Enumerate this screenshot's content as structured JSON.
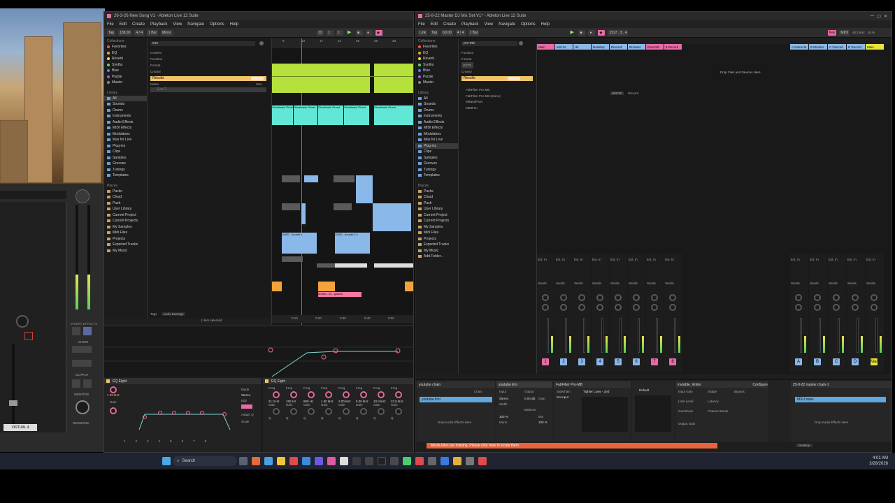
{
  "left_window": {
    "title": "26-3-26 New Song V1 - Ableton Live 12 Suite",
    "menu": [
      "File",
      "Edit",
      "Create",
      "Playback",
      "View",
      "Navigate",
      "Options",
      "Help"
    ],
    "transport": {
      "tap": "Tap",
      "tempo": "138.00",
      "sig": "4 / 4",
      "quant": "1 Bar",
      "key": "Minor",
      "pos1": "33",
      "pos2": "1",
      "pos3": "1"
    },
    "search_value": "eos",
    "collections_label": "Collections",
    "collections": [
      {
        "label": "Favorites",
        "color": "#ff5050"
      },
      {
        "label": "EQ",
        "color": "#f2a43a"
      },
      {
        "label": "Reverb",
        "color": "#e8e43a"
      },
      {
        "label": "Synths",
        "color": "#62d462"
      },
      {
        "label": "Blue",
        "color": "#4a8ae8"
      },
      {
        "label": "Purple",
        "color": "#a060e0"
      },
      {
        "label": "Master",
        "color": "#888888"
      }
    ],
    "library_label": "Library",
    "library": [
      "All",
      "Sounds",
      "Drums",
      "Instruments",
      "Audio Effects",
      "MIDI Effects",
      "Modulators",
      "Max for Live",
      "Plug-ins",
      "Clips",
      "Samples",
      "Grooves",
      "Tunings",
      "Templates"
    ],
    "places_label": "Places",
    "places": [
      "Packs",
      "Cloud",
      "Push",
      "User Library",
      "Current Project",
      "Current Projects",
      "My Samples",
      "Midi Files",
      "Projects",
      "Exported Tracks",
      "My Music"
    ],
    "filters": [
      "Content",
      "Function",
      "Format",
      "Creator"
    ],
    "results_label": "Results",
    "name_header": "Name",
    "size_header": "Size",
    "result_item": "Eos 2",
    "tags_label": "Tags",
    "tags_value": "Audio Damage",
    "status": "1 item selected",
    "clips_cyan": [
      "Ghosthack Ghost",
      "Ghosthack Ghost",
      "Ghosthack Ghost",
      "Ghosthack Ghost",
      "Ghosthack Ghost"
    ],
    "clips_lead": [
      "LEAD - Arcade 1",
      "LEAD - Arcade 1",
      "LEAD - Arcade 2.1",
      "LEAD - Arcade 2.1"
    ],
    "clip_pink": "breath - 02 - golden",
    "ruler": [
      "9",
      "13",
      "17",
      "21",
      "25",
      "29",
      "33"
    ],
    "time_ruler": [
      "0:10",
      "0:20",
      "0:30",
      "0:40",
      "0:50"
    ],
    "device_left": {
      "name": "EQ Eight",
      "mode": "Mode",
      "stereo": "Stereo",
      "edit": "Edit",
      "scale": "Scale",
      "gain": "Gain",
      "adapt": "Adapt. Q",
      "freq": "7.29 kHz",
      "bands": [
        "1",
        "2",
        "3",
        "4",
        "5",
        "6",
        "7",
        "8"
      ]
    },
    "device_right": {
      "name": "EQ Eight",
      "freq_label": "Freq",
      "gain_label": "Gain",
      "q_label": "Q",
      "freqs": [
        "21.0 Hz",
        "150 Hz",
        "800 Hz",
        "1.00 kHz",
        "2.00 kHz",
        "5.00 kHz",
        "10.0 kHz",
        "22.0 kHz"
      ]
    }
  },
  "right_window": {
    "title": "25-9-22 Master DJ Mix Set V1* - Ableton Live 12 Suite",
    "menu": [
      "File",
      "Edit",
      "Create",
      "Playback",
      "View",
      "Navigate",
      "Options",
      "Help"
    ],
    "transport": {
      "link": "Link",
      "tap": "Tap",
      "tempo": "60.00",
      "sig": "4 / 4",
      "quant": "1 Bar",
      "key": "Key",
      "midi": "MIDI",
      "sr": "44.1 kHz",
      "cpu": "15 %",
      "pos": "1517 . 3 . 4"
    },
    "search_value": "pro-mb",
    "collections_label": "Collections",
    "collections": [
      {
        "label": "Favorites",
        "color": "#ff5050"
      },
      {
        "label": "EQ",
        "color": "#f2a43a"
      },
      {
        "label": "Reverb",
        "color": "#e8e43a"
      },
      {
        "label": "Synths",
        "color": "#62d462"
      },
      {
        "label": "Blue",
        "color": "#4a8ae8"
      },
      {
        "label": "Purple",
        "color": "#a060e0"
      },
      {
        "label": "Master",
        "color": "#888888"
      }
    ],
    "library_label": "Library",
    "library": [
      "All",
      "Sounds",
      "Drums",
      "Instruments",
      "Audio Effects",
      "MIDI Effects",
      "Modulators",
      "Max for Live",
      "Plug-ins",
      "Clips",
      "Samples",
      "Grooves",
      "Tunings",
      "Templates"
    ],
    "places_label": "Places",
    "places": [
      "Packs",
      "Cloud",
      "Push",
      "User Library",
      "Current Project",
      "Current Projects",
      "My Samples",
      "Midi Files",
      "Projects",
      "Exported Tracks",
      "My Music",
      "Add Folder..."
    ],
    "filters": [
      "Function",
      "Format",
      "VST3",
      "Creator"
    ],
    "results_label": "Results",
    "results": [
      "FabFilter Pro-MB",
      "FabFilter Pro-MB (Mono)",
      "MBandPass",
      "MBitFun"
    ],
    "tracks": [
      {
        "name": "Main",
        "color": "#e86aa6"
      },
      {
        "name": "Mid Gr",
        "color": "#8ab8e8"
      },
      {
        "name": "Hit",
        "color": "#8ab8e8"
      },
      {
        "name": "Desktop",
        "color": "#8ab8e8"
      },
      {
        "name": "Discord",
        "color": "#8ab8e8"
      },
      {
        "name": "Browser",
        "color": "#8ab8e8"
      },
      {
        "name": "Rekordb",
        "color": "#e86aa6"
      },
      {
        "name": "8 Record",
        "color": "#e86aa6"
      }
    ],
    "return_tracks": [
      {
        "name": "A Game M",
        "color": "#8ab8e8"
      },
      {
        "name": "B Monitor",
        "color": "#8ab8e8"
      },
      {
        "name": "C Discord",
        "color": "#8ab8e8"
      },
      {
        "name": "D Record",
        "color": "#8ab8e8"
      },
      {
        "name": "Main",
        "color": "#e8e43a"
      }
    ],
    "drop_hint": "Drop Files and Devices Here",
    "write_label": "WRITE",
    "discord_label": "Discord",
    "audio_to": "Audio To",
    "ext_in": "Ext. In",
    "main_label": "Main",
    "sends_label": "Sends",
    "monitor": [
      "In",
      "Auto",
      "Off"
    ],
    "channel_numbers": [
      "1",
      "2",
      "3",
      "4",
      "5",
      "6",
      "7",
      "8"
    ],
    "return_letters": [
      "A",
      "B",
      "C",
      "D"
    ],
    "device_chain": {
      "youtube_chain": "youtube chain",
      "chain_label": "Chain",
      "chain_item": "youtube limi",
      "drop_audio": "Drop Audio Effects Here",
      "input": "Input",
      "output": "Output",
      "stereo": "Stereo",
      "width": "Width",
      "balance": "Balance",
      "gain": "Gain",
      "mix": "Mix",
      "mono": "Mono",
      "width_value": "100 %",
      "gain_value": "0.00 dB",
      "mix_value": "100 %",
      "sidechain": "Sidechain",
      "no_input": "No Input",
      "fabfilter": "FabFilter Pro-MB",
      "tighter": "Tighter Lows - Zed",
      "default": "Default",
      "limiter_name": "invisible_limiter",
      "input_gain": "Input Gain",
      "shape": "Shape",
      "bypass": "Bypass",
      "limit_level": "Limit Level",
      "latency": "Latency",
      "overshoot": "Overshoot",
      "channel_mode": "Channel Mode",
      "output_gain": "Output Gain",
      "configure": "Configure",
      "master_chain": "25-9-22 master chain-1",
      "master_item": "MSU trans",
      "master_drop": "Drop Audio Effects Here"
    },
    "notice": "Media Files are missing. Please click here to locate them.",
    "status_right": "Desktop"
  },
  "ua_panel": {
    "label": "VIRTUAL 4",
    "insert_effects": "INSERT EFFECTS",
    "show": "SHOW",
    "output": "OUTPUT",
    "monitor": "MONITOR",
    "sessions": "SESSIONS"
  },
  "taskbar": {
    "search": "Search",
    "time": "4:01 AM",
    "date": "3/28/2026"
  }
}
